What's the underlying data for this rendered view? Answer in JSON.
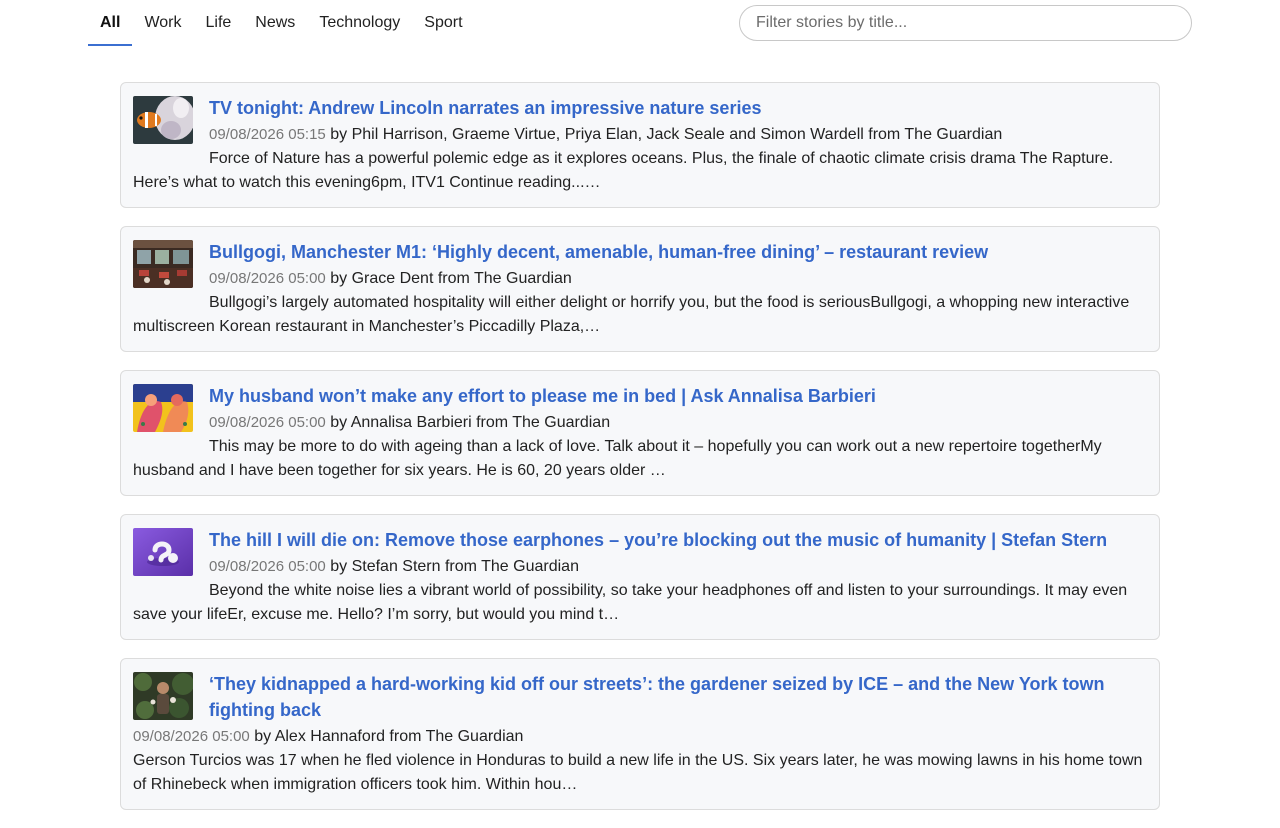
{
  "nav": {
    "tabs": [
      {
        "label": "All",
        "active": true
      },
      {
        "label": "Work"
      },
      {
        "label": "Life"
      },
      {
        "label": "News"
      },
      {
        "label": "Technology"
      },
      {
        "label": "Sport"
      }
    ]
  },
  "search": {
    "placeholder": "Filter stories by title...",
    "value": ""
  },
  "stories": [
    {
      "title": "TV tonight: Andrew Lincoln narrates an impressive nature series",
      "date": "09/08/2026 05:15",
      "byline": "by Phil Harrison, Graeme Virtue, Priya Elan, Jack Seale and Simon Wardell from The Guardian",
      "summary": "Force of Nature has a powerful polemic edge as it explores oceans. Plus, the finale of chaotic climate crisis drama The Rapture. Here’s what to watch this evening6pm, ITV1 Continue reading...…",
      "thumb_icon": "clownfish-anemone-image"
    },
    {
      "title": "Bullgogi, Manchester M1: ‘Highly decent, amenable, human-free dining’ – restaurant review",
      "date": "09/08/2026 05:00",
      "byline": "by Grace Dent from The Guardian",
      "summary": "Bullgogi’s largely automated hospitality will either delight or horrify you, but the food is seriousBullgogi, a whopping new interactive multiscreen Korean restaurant in Manchester’s Piccadilly Plaza,…",
      "thumb_icon": "restaurant-interior-image"
    },
    {
      "title": "My husband won’t make any effort to please me in bed | Ask Annalisa Barbieri",
      "date": "09/08/2026 05:00",
      "byline": "by Annalisa Barbieri from The Guardian",
      "summary": "This may be more to do with ageing than a lack of love. Talk about it – hopefully you can work out a new repertoire togetherMy husband and I have been together for six years. He is 60, 20 years older …",
      "thumb_icon": "illustration-couple-image"
    },
    {
      "title": "The hill I will die on: Remove those earphones – you’re blocking out the music of humanity | Stefan Stern",
      "date": "09/08/2026 05:00",
      "byline": "by Stefan Stern from The Guardian",
      "summary": "Beyond the white noise lies a vibrant world of possibility, so take your headphones off and listen to your surroundings. It may even save your lifeEr, excuse me. Hello? I’m sorry, but would you mind t…",
      "thumb_icon": "earphones-image"
    },
    {
      "title": "‘They kidnapped a hard-working kid off our streets’: the gardener seized by ICE – and the New York town fighting back",
      "date": "09/08/2026 05:00",
      "byline": "by Alex Hannaford from The Guardian",
      "summary": "Gerson Turcios was 17 when he fled violence in Honduras to build a new life in the US. Six years later, he was mowing lawns in his home town of Rhinebeck when immigration officers took him. Within hou…",
      "thumb_icon": "gardener-image"
    }
  ]
}
